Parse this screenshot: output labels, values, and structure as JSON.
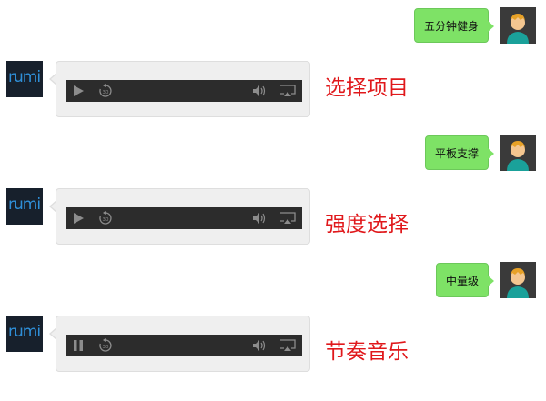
{
  "messages": [
    {
      "type": "user",
      "text": "五分钟健身"
    },
    {
      "type": "bot",
      "label": "选择项目",
      "state": "paused"
    },
    {
      "type": "user",
      "text": "平板支撑"
    },
    {
      "type": "bot",
      "label": "强度选择",
      "state": "paused"
    },
    {
      "type": "user",
      "text": "中量级"
    },
    {
      "type": "bot",
      "label": "节奏音乐",
      "state": "playing"
    }
  ],
  "bot_logo_text": "rumi",
  "player": {
    "skip_seconds": "30"
  },
  "colors": {
    "user_bubble": "#7ee266",
    "label_red": "#e0181b",
    "player_bg": "#2c2c2c",
    "bot_bubble": "#efefef"
  },
  "icons": {
    "play": "play-icon",
    "pause": "pause-icon",
    "rewind": "rewind-30-icon",
    "volume": "volume-icon",
    "airplay": "airplay-icon",
    "user_avatar": "user-avatar-icon"
  }
}
